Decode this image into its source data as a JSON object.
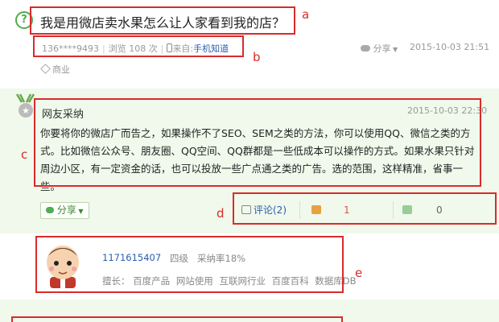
{
  "question": {
    "icon": "question-icon",
    "title": "我是用微店卖水果怎么让人家看到我的店？",
    "asker": "136****9493",
    "views": "浏览 108 次",
    "source_label": "来自:",
    "source_value": "手机知道",
    "share_label": "分享",
    "time": "2015-10-03 21:51",
    "tag": "商业"
  },
  "answer": {
    "author": "网友采纳",
    "time": "2015-10-03 22:30",
    "body": "你要将你的微店广而告之，如果操作不了SEO、SEM之类的方法，你可以使用QQ、微信之类的方式。比如微信公众号、朋友圈、QQ空间、QQ群都是一些低成本可以操作的方式。如果水果只针对周边小区，有一定资金的话，也可以投放一些广点通之类的广告。选的范围，这样精准，省事一些。",
    "share_label": "分享",
    "comment_label": "评论(2)",
    "like_count": "1",
    "dislike_count": "0"
  },
  "user_card": {
    "name": "1171615407",
    "level": "四级",
    "adopt_rate": "采纳率18%",
    "expertise_label": "擅长：",
    "expertise": [
      "百度产品",
      "网站使用",
      "互联网行业",
      "百度百科",
      "数据库DB"
    ]
  },
  "annotations": {
    "a": "a",
    "b": "b",
    "c": "c",
    "d": "d",
    "e": "e"
  },
  "colors": {
    "annotation_red": "#d92b2b",
    "band_green": "#f0f9ec",
    "link_blue": "#2a5db0",
    "accent_green": "#4caf50"
  }
}
